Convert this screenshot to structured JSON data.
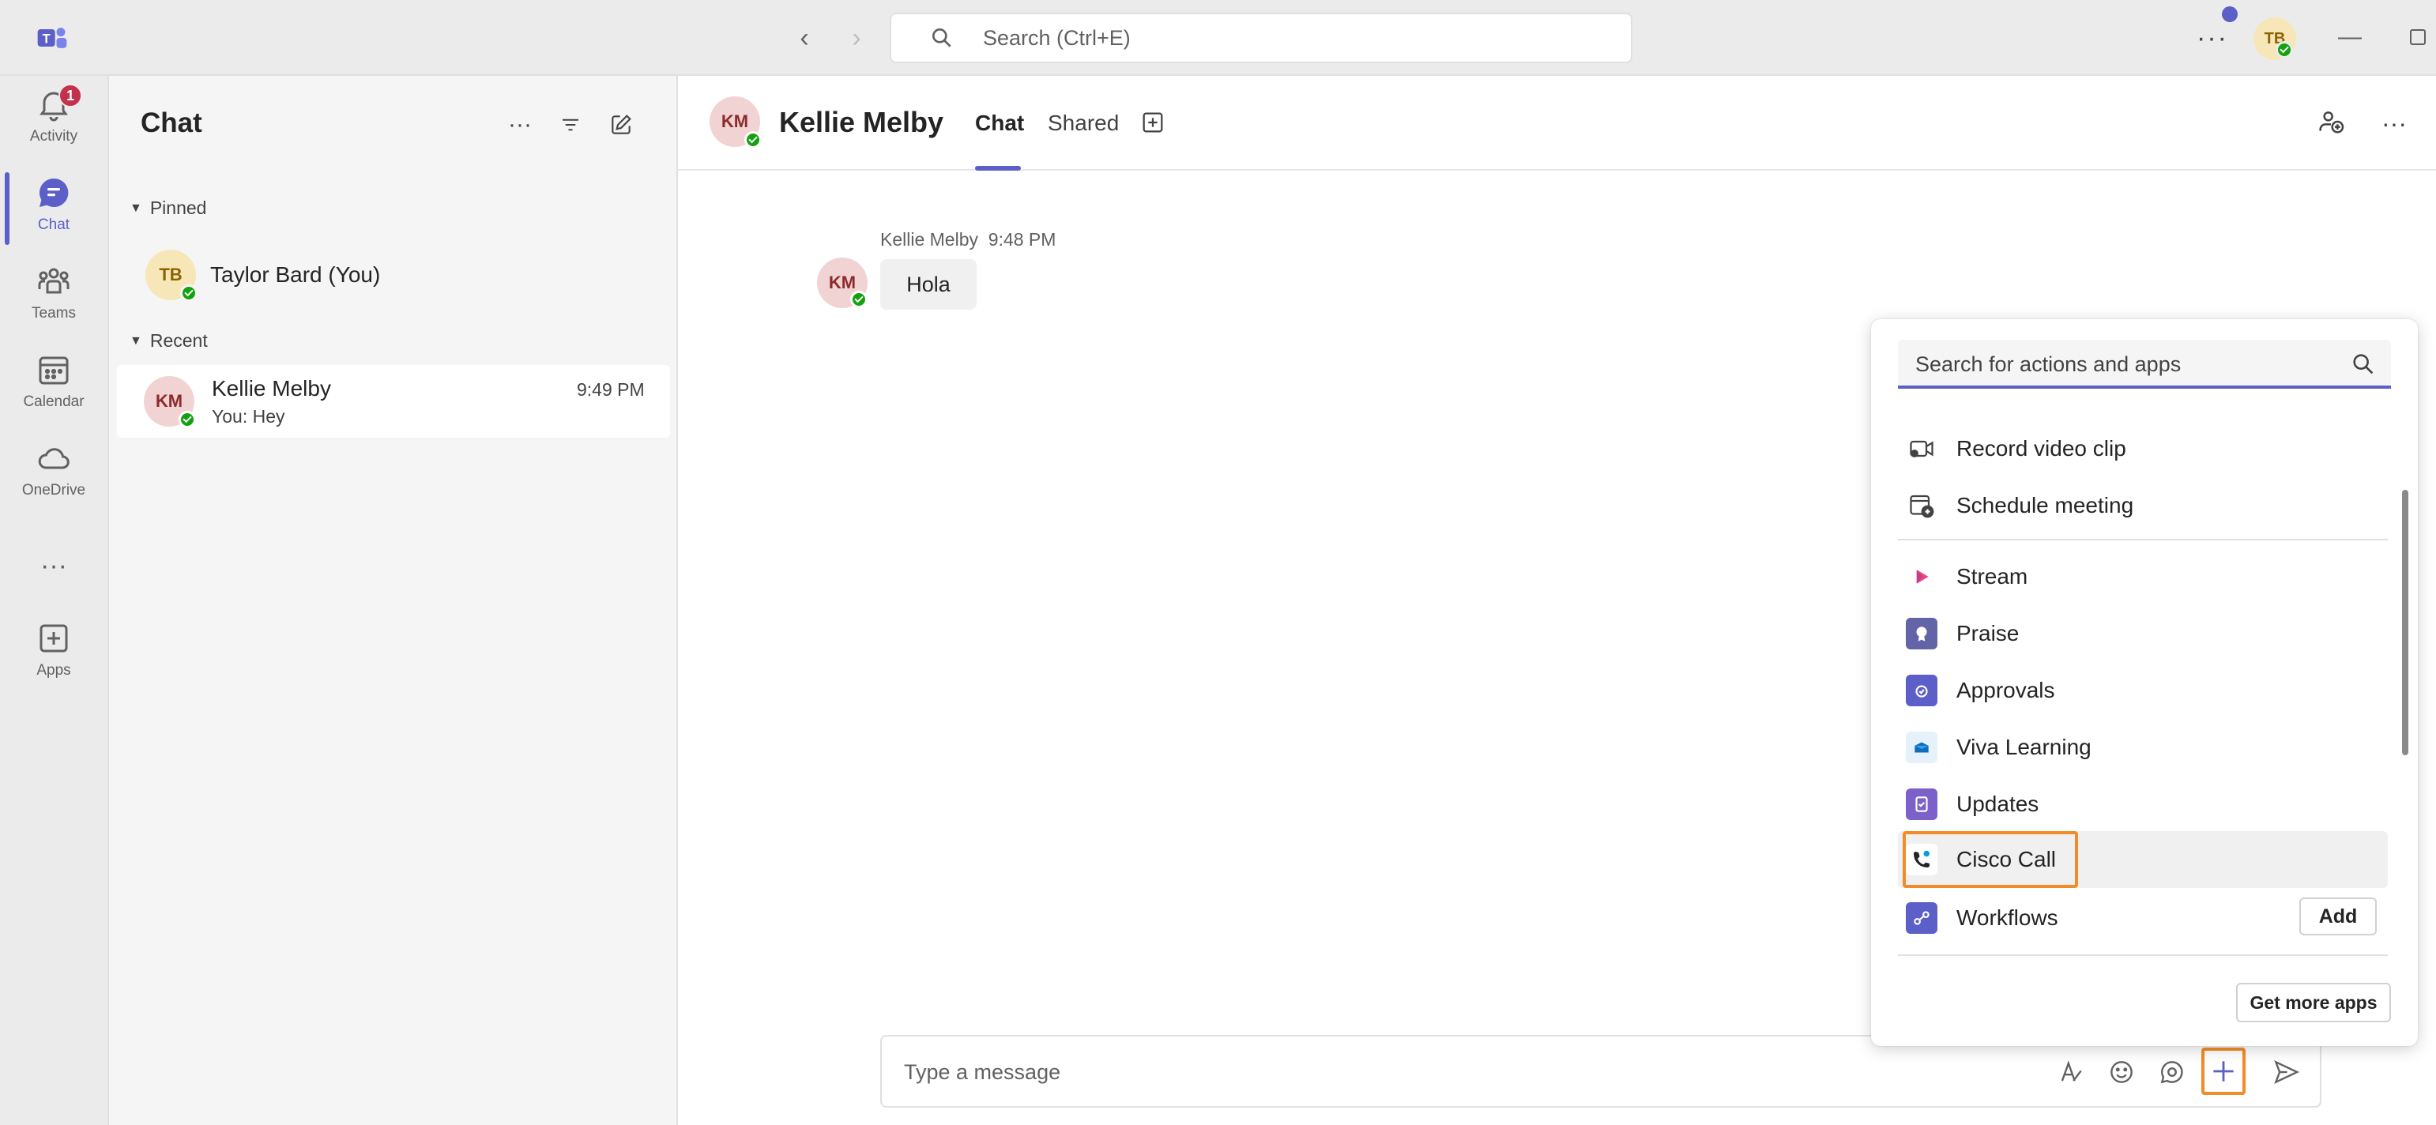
{
  "titlebar": {
    "search_placeholder": "Search (Ctrl+E)",
    "user_initials": "TB"
  },
  "rail": {
    "items": [
      {
        "label": "Activity",
        "badge": "1"
      },
      {
        "label": "Chat"
      },
      {
        "label": "Teams"
      },
      {
        "label": "Calendar"
      },
      {
        "label": "OneDrive"
      },
      {
        "label": "Apps"
      }
    ]
  },
  "chatlist": {
    "title": "Chat",
    "pinned_header": "Pinned",
    "recent_header": "Recent",
    "pinned": [
      {
        "initials": "TB",
        "name": "Taylor Bard (You)"
      }
    ],
    "recent": [
      {
        "initials": "KM",
        "name": "Kellie Melby",
        "time": "9:49 PM",
        "preview": "You: Hey"
      }
    ]
  },
  "conversation": {
    "contact_initials": "KM",
    "contact_name": "Kellie Melby",
    "tabs": [
      "Chat",
      "Shared"
    ],
    "messages": [
      {
        "sender": "Kellie Melby",
        "time": "9:48 PM",
        "text": "Hola",
        "initials": "KM"
      }
    ],
    "compose_placeholder": "Type a message"
  },
  "apps_popup": {
    "search_placeholder": "Search for actions and apps",
    "actions": [
      {
        "label": "Record video clip",
        "icon": "video-clip-icon"
      },
      {
        "label": "Schedule meeting",
        "icon": "calendar-add-icon"
      }
    ],
    "apps": [
      {
        "label": "Stream",
        "icon": "stream-icon",
        "color": "#e8467c"
      },
      {
        "label": "Praise",
        "icon": "praise-icon",
        "color": "#6264a7"
      },
      {
        "label": "Approvals",
        "icon": "approvals-icon",
        "color": "#5b5fc7"
      },
      {
        "label": "Viva Learning",
        "icon": "viva-learning-icon",
        "color": "#0f6cbd"
      },
      {
        "label": "Updates",
        "icon": "updates-icon",
        "color": "#7b61c9"
      },
      {
        "label": "Cisco Call",
        "icon": "cisco-call-icon",
        "color": "#049fd9"
      },
      {
        "label": "Workflows",
        "icon": "workflows-icon",
        "color": "#5b5fc7"
      }
    ],
    "add_label": "Add",
    "get_more_label": "Get more apps"
  },
  "colors": {
    "accent": "#5b5fc7",
    "highlight": "#f28c28",
    "presence": "#13a10e"
  }
}
